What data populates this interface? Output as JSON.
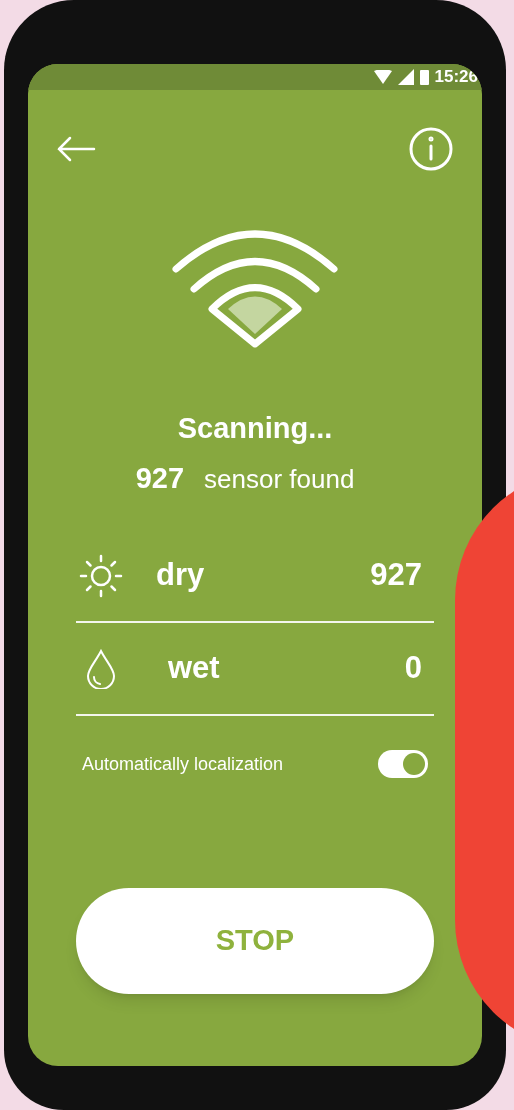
{
  "status_bar": {
    "time": "15:26"
  },
  "scan": {
    "title": "Scanning...",
    "count": "927",
    "count_label": "sensor found"
  },
  "readings": [
    {
      "kind": "dry",
      "label": "dry",
      "value": "927"
    },
    {
      "kind": "wet",
      "label": "wet",
      "value": "0"
    }
  ],
  "localization": {
    "label": "Automatically localization",
    "on": true
  },
  "stop_button": {
    "label": "STOP"
  }
}
